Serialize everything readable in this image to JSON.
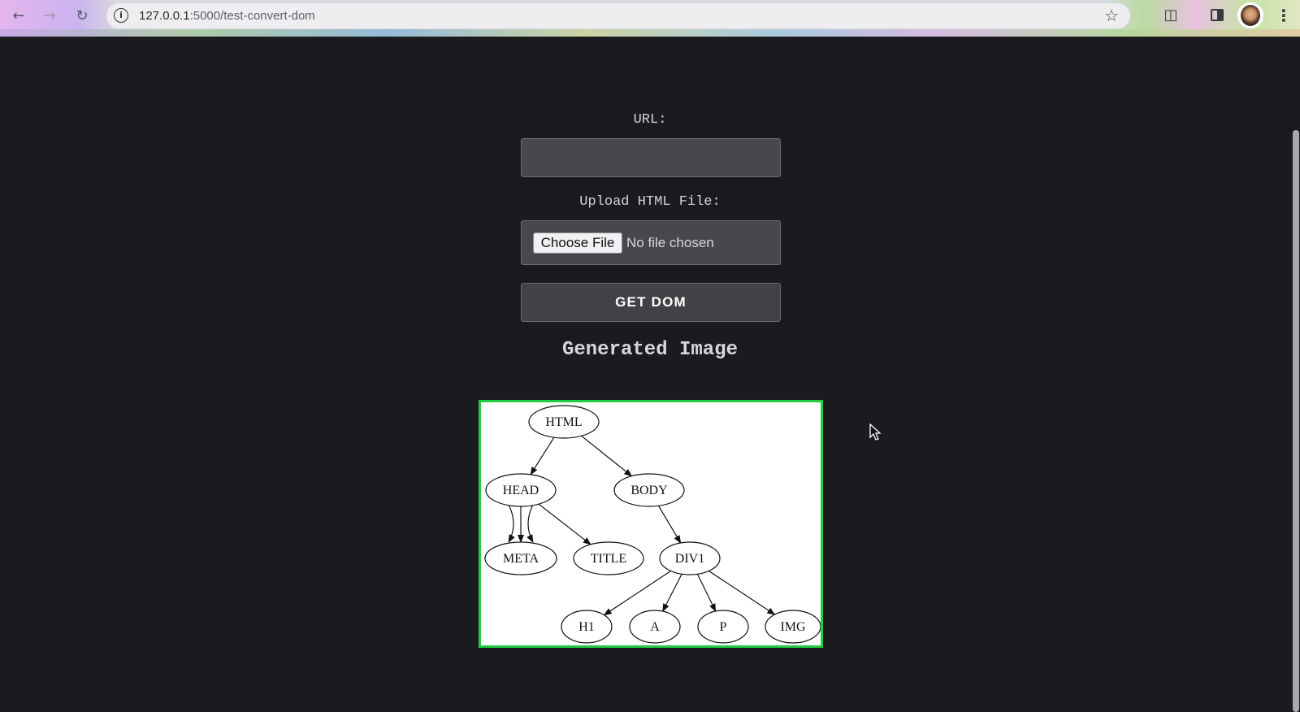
{
  "browser": {
    "url_host": "127.0.0.1",
    "url_path": ":5000/test-convert-dom",
    "icons": {
      "back": "arrow-left-icon",
      "forward": "arrow-right-icon",
      "reload": "reload-icon",
      "info": "info-icon",
      "bookmark": "star-icon",
      "extensions": "puzzle-icon",
      "side_panel": "side-panel-icon",
      "profile": "avatar",
      "menu": "kebab-menu-icon"
    }
  },
  "form": {
    "url_label": "URL:",
    "url_value": "",
    "upload_label": "Upload HTML File:",
    "choose_file_label": "Choose File",
    "no_file_text": "No file chosen",
    "submit_label": "GET DOM"
  },
  "result": {
    "title": "Generated Image",
    "frame_color": "#22cc44",
    "tree": {
      "nodes": [
        {
          "id": "html",
          "label": "HTML"
        },
        {
          "id": "head",
          "label": "HEAD"
        },
        {
          "id": "body",
          "label": "BODY"
        },
        {
          "id": "meta",
          "label": "META"
        },
        {
          "id": "title",
          "label": "TITLE"
        },
        {
          "id": "div1",
          "label": "DIV1"
        },
        {
          "id": "h1",
          "label": "H1"
        },
        {
          "id": "a",
          "label": "A"
        },
        {
          "id": "p",
          "label": "P"
        },
        {
          "id": "img",
          "label": "IMG"
        }
      ],
      "edges": [
        [
          "html",
          "head"
        ],
        [
          "html",
          "body"
        ],
        [
          "head",
          "meta"
        ],
        [
          "head",
          "meta"
        ],
        [
          "head",
          "meta"
        ],
        [
          "head",
          "title"
        ],
        [
          "body",
          "div1"
        ],
        [
          "div1",
          "h1"
        ],
        [
          "div1",
          "a"
        ],
        [
          "div1",
          "p"
        ],
        [
          "div1",
          "img"
        ]
      ]
    }
  },
  "colors": {
    "page_bg": "#1b1b1f",
    "input_bg": "#48484c",
    "button_bg": "#424246",
    "text": "#d4d4d8"
  }
}
